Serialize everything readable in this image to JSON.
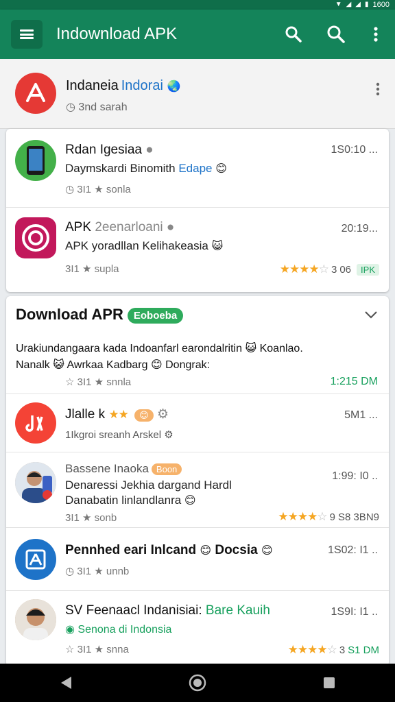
{
  "status_bar": {
    "time": "1600"
  },
  "appbar": {
    "title": "Indownload APK"
  },
  "featured": {
    "title": "Indaneia",
    "title_blue": "Indorai",
    "sub": "3nd sarah"
  },
  "card1": {
    "rows": [
      {
        "title": "Rdan Igesiaa",
        "line": "Daymskardi Binomith",
        "line_blue": "Edape",
        "meta": "3I1 ★ sonla",
        "time": "1S0:10 ..."
      },
      {
        "title": "APK",
        "title_gray": "2eenarloani",
        "line": "APK yoradllan Kelihakeasia",
        "meta": "3I1 ★ supla",
        "time": "20:19...",
        "rating_num": "3",
        "rating_extra": "06",
        "tag": "IPK"
      }
    ]
  },
  "card2": {
    "header": "Download APR",
    "pill": "Eoboeba",
    "intro": {
      "line1": "Urakiundangaara kada Indoanfarl earondalritin",
      "line1_end": "Koanlao.",
      "line2a": "Nanalk",
      "line2b": "Awrkaa Kadbarg",
      "line2c": "Dongrak:",
      "meta": "3I1 ★ snnla",
      "time": "1:215 DM"
    },
    "rows": [
      {
        "title": "Jlalle k",
        "meta": "1Ikgroi sreanh Arskel",
        "time": "5M1 ..."
      },
      {
        "title": "Bassene Inaoka",
        "badge": "Boon",
        "line1": "Denaressi Jekhia dargand Hardl",
        "line2": "Danabatin linlandlanra",
        "meta": "3I1 ★ sonb",
        "time": "1:99: I0 ..",
        "rating_num": "9",
        "rating_extra": "S8 3BN9"
      },
      {
        "title": "Pennhed eari Inlcand",
        "title2": "Docsia",
        "meta": "3I1 ★ unnb",
        "time": "1S02: I1 .."
      },
      {
        "title": "SV Feenaacl Indanisiai:",
        "title_green": "Bare Kauih",
        "line_green": "Senona di Indonsia",
        "meta": "3I1 ★ snna",
        "time": "1S9I: I1 ..",
        "rating_num": "3",
        "rating_extra": "S1 DM"
      }
    ]
  }
}
